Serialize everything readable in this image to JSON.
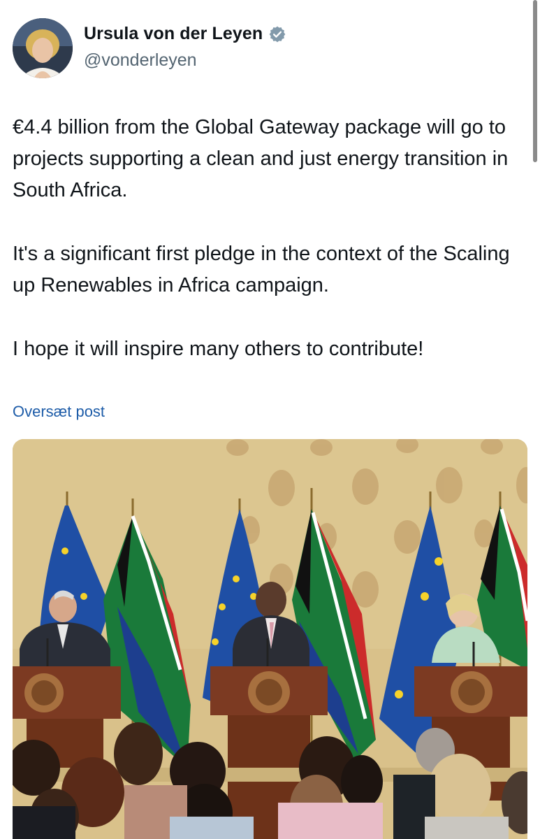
{
  "author": {
    "name": "Ursula von der Leyen",
    "handle": "@vonderleyen",
    "verified_icon": "verified-badge-icon"
  },
  "tweet": {
    "paragraphs": [
      "€4.4 billion from the Global Gateway package will go to projects supporting a clean and just energy transition in South Africa.",
      "It's a significant first pledge in the context of the Scaling up Renewables in Africa campaign.",
      "I hope it will inspire many others to contribute!"
    ],
    "translate_label": "Oversæt post"
  },
  "colors": {
    "link": "#1d5ca8",
    "verified": "#829aab",
    "handle": "#536471",
    "wall": "#d9c18a"
  }
}
